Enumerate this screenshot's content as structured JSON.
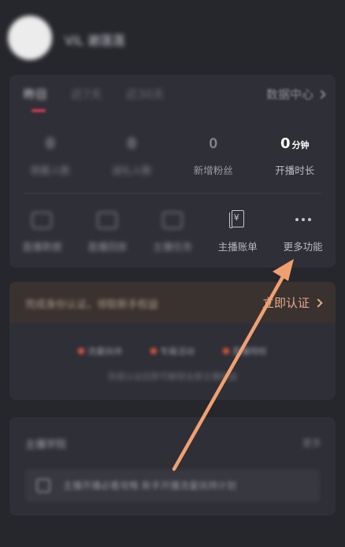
{
  "header": {
    "nickname": "ViL 谢莲莲"
  },
  "card_stats": {
    "tabs": [
      {
        "label": "昨日",
        "active": true
      },
      {
        "label": "近7天",
        "active": false
      },
      {
        "label": "近30天",
        "active": false
      }
    ],
    "data_center_label": "数据中心",
    "stats": [
      {
        "value": "0",
        "label": "观看人数"
      },
      {
        "value": "0",
        "label": "送礼人数"
      },
      {
        "value": "0",
        "label": "新增粉丝"
      },
      {
        "value": "0",
        "unit": "分钟",
        "label": "开播时长"
      }
    ],
    "tools": [
      {
        "label": "直播数据",
        "icon": "chart-icon"
      },
      {
        "label": "直播回放",
        "icon": "replay-icon"
      },
      {
        "label": "主播任务",
        "icon": "task-icon"
      },
      {
        "label": "主播账单",
        "icon": "bill-icon"
      },
      {
        "label": "更多功能",
        "icon": "more-dots-icon"
      }
    ]
  },
  "card_certify": {
    "banner_text": "完成身份认证，领取新手权益",
    "certify_label": "立即认证",
    "perks": [
      "流量扶持",
      "专属活动",
      "直播特权"
    ],
    "perk_sub": "完成认证后即可解锁全部主播权益"
  },
  "card_notice": {
    "title": "主播学院",
    "more_label": "更多",
    "notice_text": "主播开播必看攻略  新手开播流量扶持计划"
  },
  "colors": {
    "background": "#26262d",
    "card": "#2f2f37",
    "accent_red": "#ff3c5a",
    "certify_orange": "#e3a98a",
    "arrow": "#f0a070"
  }
}
